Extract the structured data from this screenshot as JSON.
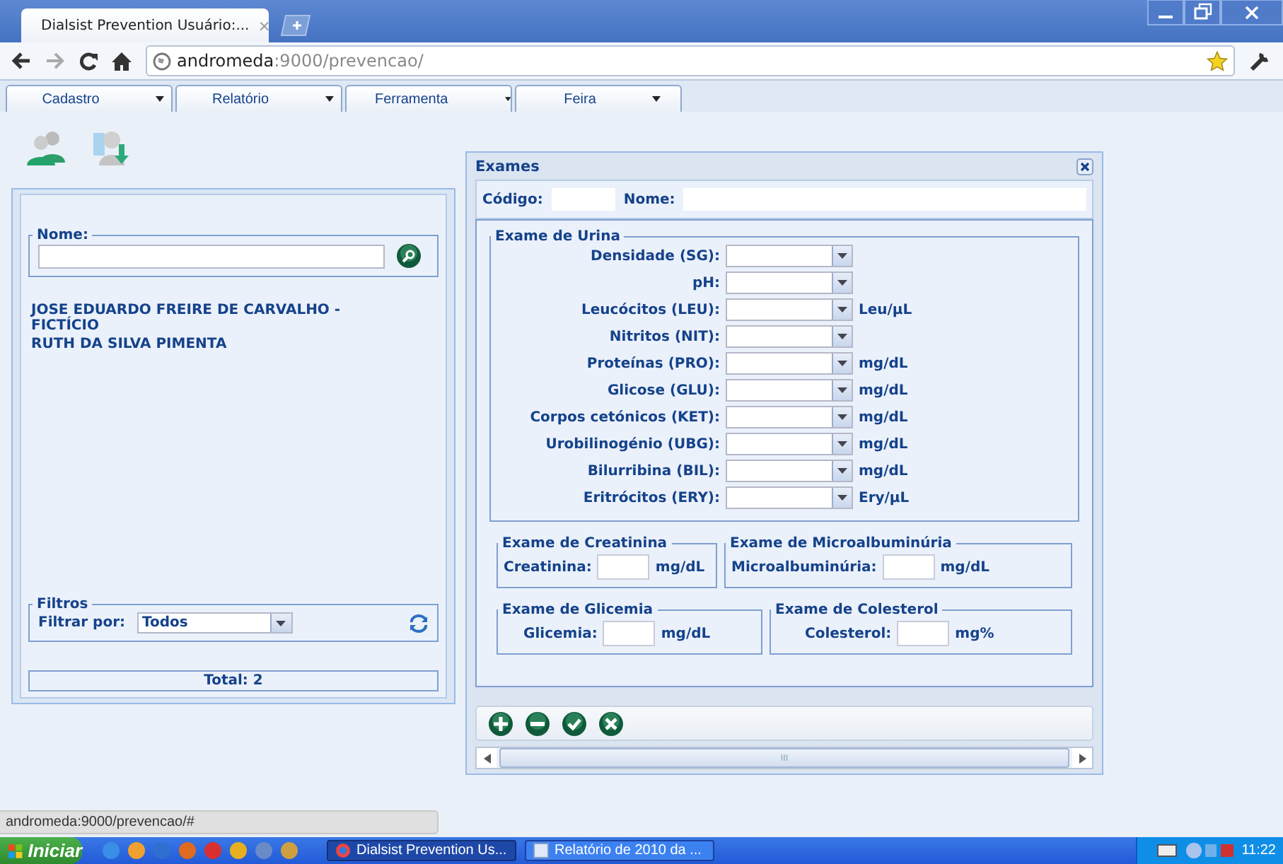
{
  "browser": {
    "tab": {
      "title": "Dialsist Prevention Usuário:...",
      "close": "×"
    },
    "url": {
      "host": "andromeda",
      "path": ":9000/prevencao/"
    }
  },
  "menu": [
    {
      "label": "Cadastro"
    },
    {
      "label": "Relatório"
    },
    {
      "label": "Ferramenta"
    },
    {
      "label": "Feira"
    }
  ],
  "left_panel": {
    "name_legend": "Nome:",
    "patients": [
      "JOSE EDUARDO FREIRE DE CARVALHO - FICTÍCIO",
      "RUTH DA SILVA PIMENTA"
    ],
    "filters_legend": "Filtros",
    "filter_label": "Filtrar por:",
    "filter_value": "Todos",
    "total": "Total: 2"
  },
  "dialog": {
    "title": "Exames",
    "code_label": "Código:",
    "name_label": "Nome:",
    "urine": {
      "legend": "Exame de Urina",
      "rows": [
        {
          "label": "Densidade (SG):"
        },
        {
          "label": "pH:"
        },
        {
          "label": "Leucócitos (LEU):",
          "unit": "Leu/µL"
        },
        {
          "label": "Nitritos (NIT):"
        },
        {
          "label": "Proteínas (PRO):",
          "unit": "mg/dL"
        },
        {
          "label": "Glicose (GLU):",
          "unit": "mg/dL"
        },
        {
          "label": "Corpos cetónicos (KET):",
          "unit": "mg/dL"
        },
        {
          "label": "Urobilinogénio (UBG):",
          "unit": "mg/dL"
        },
        {
          "label": "Bilurribina (BIL):",
          "unit": "mg/dL"
        },
        {
          "label": "Eritrócitos (ERY):",
          "unit": "Ery/µL"
        }
      ]
    },
    "groups": [
      {
        "legend": "Exame de Creatinina",
        "label": "Creatinina:",
        "unit": "mg/dL"
      },
      {
        "legend": "Exame de Microalbuminúria",
        "label": "Microalbuminúria:",
        "unit": "mg/dL"
      },
      {
        "legend": "Exame de Glicemia",
        "label": "Glicemia:",
        "unit": "mg/dL"
      },
      {
        "legend": "Exame de Colesterol",
        "label": "Colesterol:",
        "unit": "mg%"
      }
    ],
    "scrollbar_grip": "III"
  },
  "status_url": "andromeda:9000/prevencao/#",
  "taskbar": {
    "start": "Iniciar",
    "tasks": [
      {
        "label": "Dialsist Prevention Us...",
        "selected": true
      },
      {
        "label": "Relatório de 2010 da ...",
        "selected": false
      }
    ],
    "clock": "11:22"
  }
}
